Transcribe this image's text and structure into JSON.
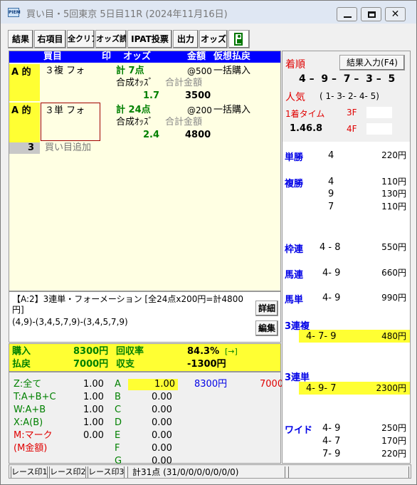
{
  "window": {
    "title": "買い目・5回東京 5日目11R (2024年11月16日)",
    "app_icon": "PIEM"
  },
  "toolbar": {
    "buttons": [
      "結果",
      "右項目",
      "全クリア",
      "オッズ読",
      "IPAT投票",
      "出力",
      "オッズ"
    ]
  },
  "bet_header": {
    "kaime": "買目",
    "shirushi": "印",
    "odds": "オッズ",
    "kingaku": "金額",
    "kaso": "仮想払戻"
  },
  "bets": [
    {
      "mark": "A 的",
      "type": "３複 フォ",
      "total": "計  7点",
      "unit": "@500",
      "method": "一括購入",
      "combo_label": "合成ｵｯｽﾞ",
      "amt_label": "合計金額",
      "combo": "1.7",
      "amount": "3500"
    },
    {
      "mark": "A 的",
      "type": "３単 フォ",
      "total": "計  24点",
      "unit": "@200",
      "method": "一括購入",
      "combo_label": "合成ｵｯｽﾞ",
      "amt_label": "合計金額",
      "combo": "2.4",
      "amount": "4800"
    }
  ],
  "add_row": {
    "num": "3",
    "label": "買い目追加"
  },
  "detail": {
    "line1": "【A:2】3連単・フォーメーション [全24点x200円=計4800円]",
    "line2": "(4,9)-(3,4,5,7,9)-(3,4,5,7,9)",
    "btn_detail": "詳細",
    "btn_edit": "編集"
  },
  "summary": {
    "buy_label": "購入",
    "buy": "8300円",
    "pay_label": "払戻",
    "pay": "7000円",
    "rate_label": "回収率",
    "rate": "84.3%",
    "rate_arrow": "[→]",
    "bal_label": "収支",
    "bal": "-1300円"
  },
  "marks": [
    {
      "label": "Z:全て",
      "val": "1.00"
    },
    {
      "label": "T:A+B+C",
      "val": "1.00"
    },
    {
      "label": "W:A+B",
      "val": "1.00"
    },
    {
      "label": "X:A(B)",
      "val": "1.00"
    },
    {
      "label": "M:マーク",
      "val": "0.00"
    },
    {
      "label": "(M金額)",
      "val": ""
    }
  ],
  "marks_abc": [
    {
      "k": "A",
      "v": "1.00",
      "amt": "8300円",
      "pay": "7000"
    },
    {
      "k": "B",
      "v": "0.00"
    },
    {
      "k": "C",
      "v": "0.00"
    },
    {
      "k": "D",
      "v": "0.00"
    },
    {
      "k": "E",
      "v": "0.00"
    },
    {
      "k": "F",
      "v": "0.00"
    },
    {
      "k": "G",
      "v": "0.00"
    }
  ],
  "results": {
    "arrival_label": "着順",
    "input_btn": "結果入力(F4)",
    "arrival": [
      "4",
      "9",
      "7",
      "3",
      "5"
    ],
    "pop_label": "人気",
    "pop": "( 1- 3- 2- 4- 5)",
    "time_label": "1着タイム",
    "time": "1.46.8",
    "f3": "3F",
    "f4": "4F",
    "payouts": [
      {
        "label": "単勝",
        "rows": [
          {
            "c": "4",
            "v": "220円"
          }
        ]
      },
      {
        "label": "複勝",
        "rows": [
          {
            "c": "4",
            "v": "110円"
          },
          {
            "c": "9",
            "v": "130円"
          },
          {
            "c": "7",
            "v": "110円"
          }
        ]
      },
      {
        "label": "枠連",
        "rows": [
          {
            "c": "4 - 8",
            "v": "550円"
          }
        ]
      },
      {
        "label": "馬連",
        "rows": [
          {
            "c": "4- 9",
            "v": "660円"
          }
        ]
      },
      {
        "label": "馬単",
        "rows": [
          {
            "c": "4- 9",
            "v": "990円"
          }
        ]
      },
      {
        "label": "3連複",
        "rows": [
          {
            "c": "4- 7- 9",
            "v": "480円"
          }
        ]
      },
      {
        "label": "3連単",
        "rows": [
          {
            "c": "4- 9- 7",
            "v": "2300円"
          }
        ]
      },
      {
        "label": "ワイド",
        "rows": [
          {
            "c": "4- 9",
            "v": "250円"
          },
          {
            "c": "4- 7",
            "v": "170円"
          },
          {
            "c": "7- 9",
            "v": "220円"
          }
        ]
      }
    ]
  },
  "status": {
    "tab1": "レース印1",
    "tab2": "レース印2",
    "tab3": "レース印3",
    "info": "計31点 (31/0/0/0/0/0/0/0)"
  }
}
